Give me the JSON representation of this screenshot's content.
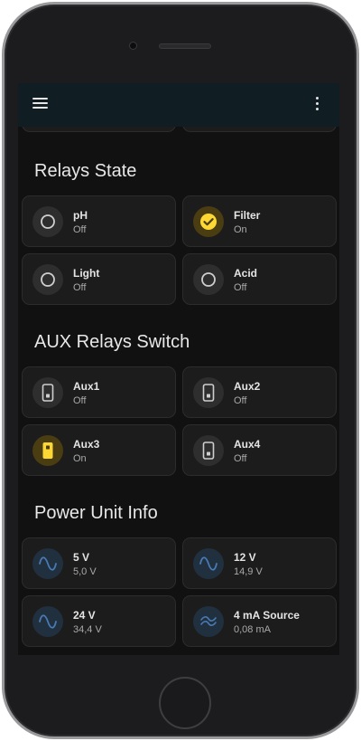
{
  "colors": {
    "accent_on": "#fdd835",
    "appbar_bg": "#101e24",
    "screen_bg": "#111111",
    "card_bg": "#1c1c1c",
    "power_icon": "#4a7ab3"
  },
  "icons": {
    "menu": "hamburger-menu",
    "more": "more-vertical",
    "relay_off": "circle-outline",
    "relay_on": "check-circle",
    "switch": "light-switch",
    "sine": "sine-wave"
  },
  "sections": [
    {
      "title": "Relays State",
      "cards": [
        {
          "name": "pH",
          "state": "Off",
          "icon": "circle-outline",
          "active": false
        },
        {
          "name": "Filter",
          "state": "On",
          "icon": "check-circle",
          "active": true
        },
        {
          "name": "Light",
          "state": "Off",
          "icon": "circle-outline",
          "active": false
        },
        {
          "name": "Acid",
          "state": "Off",
          "icon": "circle-outline",
          "active": false
        }
      ]
    },
    {
      "title": "AUX Relays Switch",
      "cards": [
        {
          "name": "Aux1",
          "state": "Off",
          "icon": "light-switch",
          "active": false
        },
        {
          "name": "Aux2",
          "state": "Off",
          "icon": "light-switch",
          "active": false
        },
        {
          "name": "Aux3",
          "state": "On",
          "icon": "light-switch",
          "active": true
        },
        {
          "name": "Aux4",
          "state": "Off",
          "icon": "light-switch",
          "active": false
        }
      ]
    },
    {
      "title": "Power Unit Info",
      "cards": [
        {
          "name": "5 V",
          "state": "5,0 V",
          "icon": "sine-wave"
        },
        {
          "name": "12 V",
          "state": "14,9 V",
          "icon": "sine-wave"
        },
        {
          "name": "24 V",
          "state": "34,4 V",
          "icon": "sine-wave"
        },
        {
          "name": "4 mA Source",
          "state": "0,08 mA",
          "icon": "current-wave"
        }
      ]
    }
  ]
}
